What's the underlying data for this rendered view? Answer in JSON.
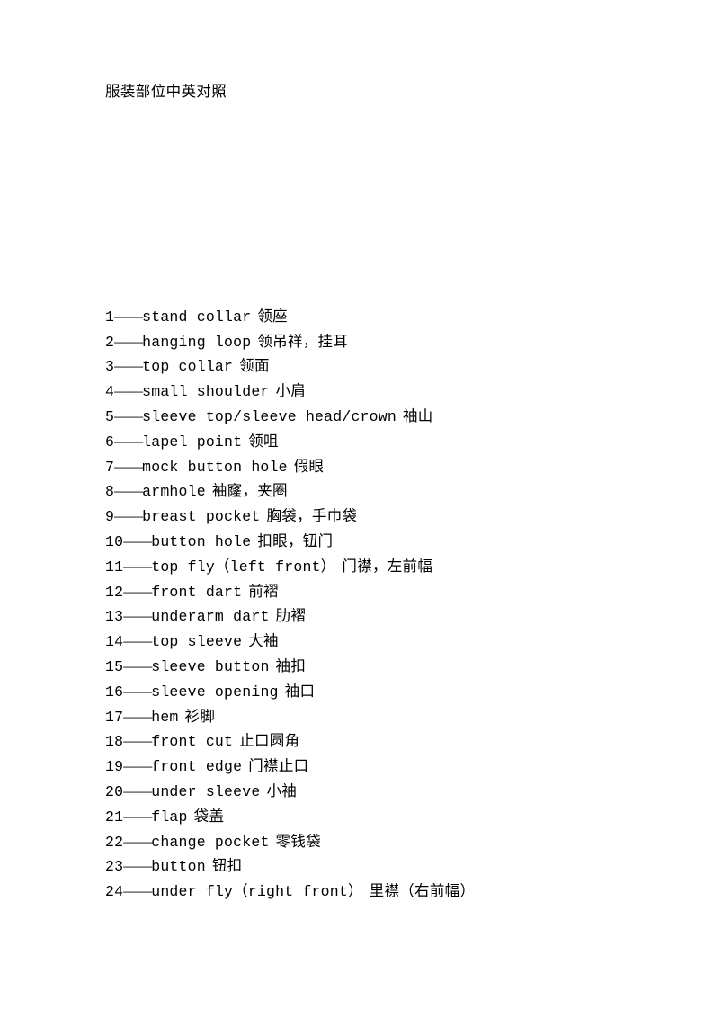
{
  "document": {
    "title": "服装部位中英对照",
    "separator": "——",
    "blank_lines_after_title": 8
  },
  "glossary": {
    "items": [
      {
        "index": "1",
        "en": "stand collar",
        "zh": "领座"
      },
      {
        "index": "2",
        "en": "hanging loop",
        "zh": "领吊祥，挂耳"
      },
      {
        "index": "3",
        "en": "top collar",
        "zh": "领面"
      },
      {
        "index": "4",
        "en": "small shoulder",
        "zh": "小肩"
      },
      {
        "index": "5",
        "en": "sleeve top/sleeve head/crown",
        "zh": "袖山"
      },
      {
        "index": "6",
        "en": "lapel point",
        "zh": "领咀"
      },
      {
        "index": "7",
        "en": "mock button hole",
        "zh": "假眼"
      },
      {
        "index": "8",
        "en": "armhole",
        "zh": "袖窿，夹圈"
      },
      {
        "index": "9",
        "en": "breast pocket",
        "zh": "胸袋，手巾袋"
      },
      {
        "index": "10",
        "en": "button hole",
        "zh": "扣眼，钮门"
      },
      {
        "index": "11",
        "en": "top fly（left front）",
        "zh": "门襟，左前幅"
      },
      {
        "index": "12",
        "en": "front dart",
        "zh": "前褶"
      },
      {
        "index": "13",
        "en": "underarm dart",
        "zh": "肋褶"
      },
      {
        "index": "14",
        "en": "top sleeve",
        "zh": "大袖"
      },
      {
        "index": "15",
        "en": "sleeve button",
        "zh": "袖扣"
      },
      {
        "index": "16",
        "en": "sleeve opening",
        "zh": "袖口"
      },
      {
        "index": "17",
        "en": "hem",
        "zh": "衫脚"
      },
      {
        "index": "18",
        "en": "front cut",
        "zh": "止口圆角"
      },
      {
        "index": "19",
        "en": "front edge",
        "zh": "门襟止口"
      },
      {
        "index": "20",
        "en": "under sleeve",
        "zh": "小袖"
      },
      {
        "index": "21",
        "en": "flap",
        "zh": "袋盖"
      },
      {
        "index": "22",
        "en": "change pocket",
        "zh": "零钱袋"
      },
      {
        "index": "23",
        "en": "button",
        "zh": "钮扣"
      },
      {
        "index": "24",
        "en": "under fly（right front）",
        "zh": "里襟（右前幅）"
      }
    ]
  },
  "colors": {
    "page_background": "#ffffff",
    "text": "#000000"
  }
}
